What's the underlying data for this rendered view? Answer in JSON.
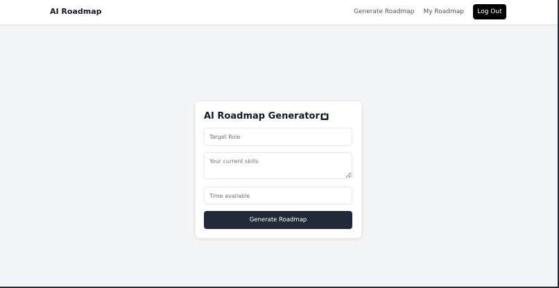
{
  "navbar": {
    "brand": "AI Roadmap",
    "links": [
      {
        "label": "Generate Roadmap"
      },
      {
        "label": "My Roadmap"
      }
    ],
    "logout_label": "Log Out"
  },
  "form": {
    "title": "AI Roadmap Generator",
    "title_icon": "map-icon",
    "target_role_placeholder": "Target Role",
    "skills_placeholder": "Your current skills",
    "time_placeholder": "Time available",
    "submit_label": "Generate Roadmap"
  },
  "colors": {
    "background": "#f3f4f6",
    "primary_button": "#1f2937",
    "logout_button": "#000000"
  }
}
